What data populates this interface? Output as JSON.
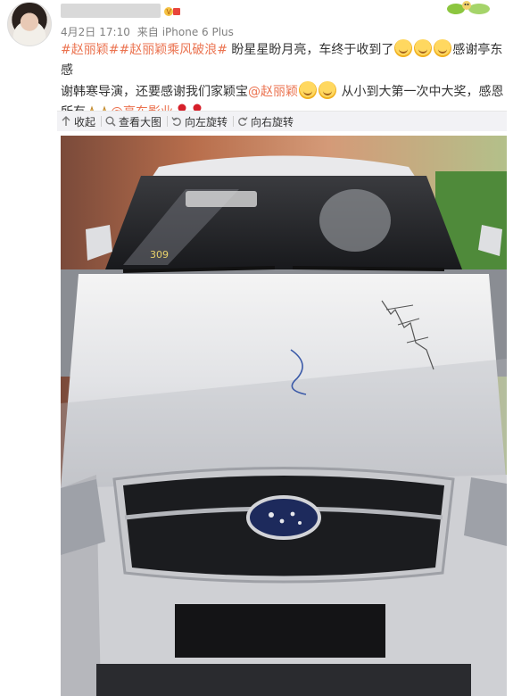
{
  "post": {
    "date": "4月2日",
    "time": "17:10",
    "source_prefix": "来自",
    "device": "iPhone 6 Plus",
    "line1": {
      "tag1": "#赵丽颖#",
      "tag2": "#赵丽颖乘风破浪#",
      "text1": " 盼星星盼月亮，车终于收到了",
      "text2": "感谢亭东感"
    },
    "line2": {
      "text1": "谢韩寒导演，还要感谢我们家颖宝",
      "mention": "@赵丽颖",
      "text2": " 从小到大第一次中大奖，感恩"
    },
    "line3": {
      "text1": "所有",
      "mention": "@亭东影业"
    }
  },
  "toolbar": {
    "collapse": "收起",
    "view_large": "查看大图",
    "rotate_left": "向左旋转",
    "rotate_right": "向右旋转"
  },
  "photo": {
    "windshield_number": "309"
  },
  "colors": {
    "link": "#eb7350",
    "toolbar_bg": "#f2f2f5"
  }
}
